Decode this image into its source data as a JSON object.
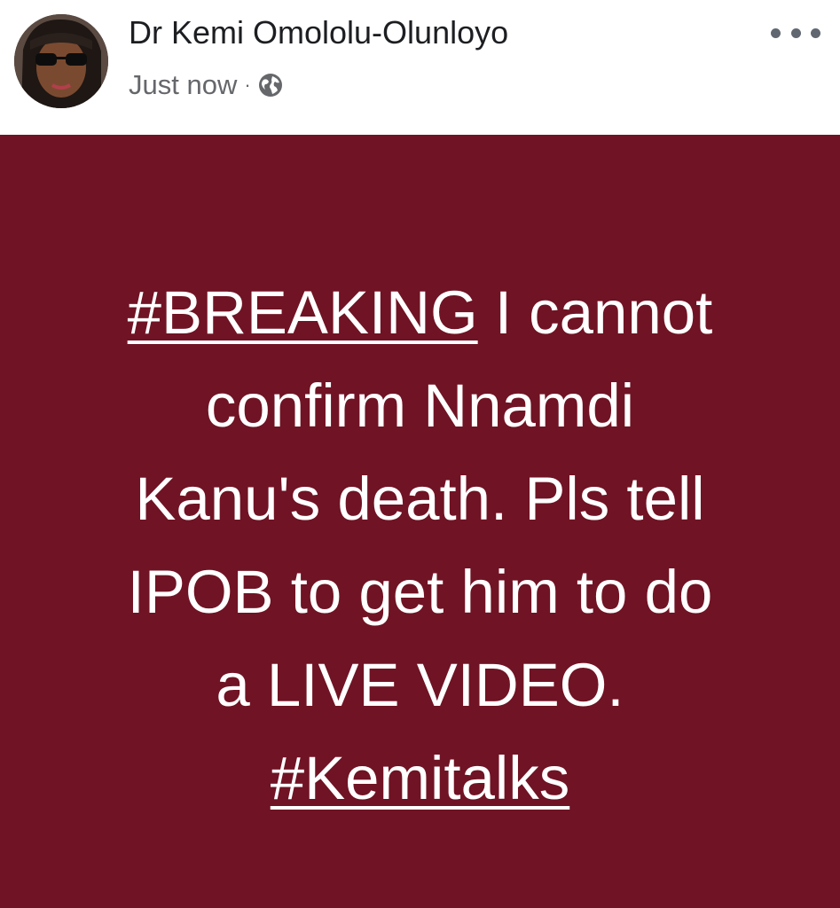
{
  "post": {
    "author": "Dr Kemi Omololu-Olunloyo",
    "time": "Just now",
    "separator": "·",
    "privacy_icon": "globe-icon",
    "more_icon": "more-options-icon",
    "background_color": "#701324",
    "text_color": "#ffffff",
    "content": {
      "hashtag_breaking": "#BREAKING",
      "line1_rest": "I cannot",
      "line2": "confirm Nnamdi",
      "line3": "Kanu's death. Pls tell",
      "line4": "IPOB to get him to do",
      "line5": "a LIVE VIDEO.",
      "hashtag_kemitalks": "#Kemitalks"
    }
  }
}
